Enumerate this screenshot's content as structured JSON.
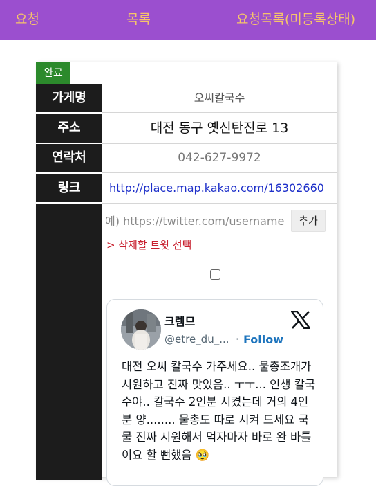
{
  "nav": {
    "left": "요청",
    "middle": "목록",
    "right": "요청목록(미등록상태)"
  },
  "card": {
    "status_badge": "완료",
    "rows": {
      "name_label": "가게명",
      "name_value": "오씨칼국수",
      "address_label": "주소",
      "address_value": "대전 동구 옛신탄진로 13",
      "phone_label": "연락처",
      "phone_value": "042-627-9972",
      "link_label": "링크",
      "link_value": "http://place.map.kakao.com/16302660"
    },
    "twitter": {
      "input_placeholder": "예) https://twitter.com/username",
      "add_button": "추가",
      "delete_label": "> 삭제할 트윗 선택"
    }
  },
  "tweet": {
    "author_name": "크렘므",
    "handle": "@etre_du_...",
    "separator": "·",
    "follow_label": "Follow",
    "text": "대전 오씨 칼국수 가주세요.. 물총조개가 시원하고 진짜 맛있음.. ㅜㅜ... 인생 칼국수야.. 칼국수 2인분 시켰는데 거의 4인분 양........ 물총도 따로 시켜 드세요 국물 진짜 시원해서 먹자마자 바로 완 바틀이요 할 뻔했음 🥹"
  },
  "colors": {
    "nav_bg": "#9b4fcf",
    "nav_text": "#f6c46a",
    "badge_bg": "#2c8a2c",
    "label_bg": "#1c1c1c",
    "link": "#1d2fc9",
    "delete": "#c8202f",
    "follow": "#1d74bd"
  },
  "icons": {
    "tweet_brand": "x-logo-icon",
    "avatar": "user-avatar"
  }
}
